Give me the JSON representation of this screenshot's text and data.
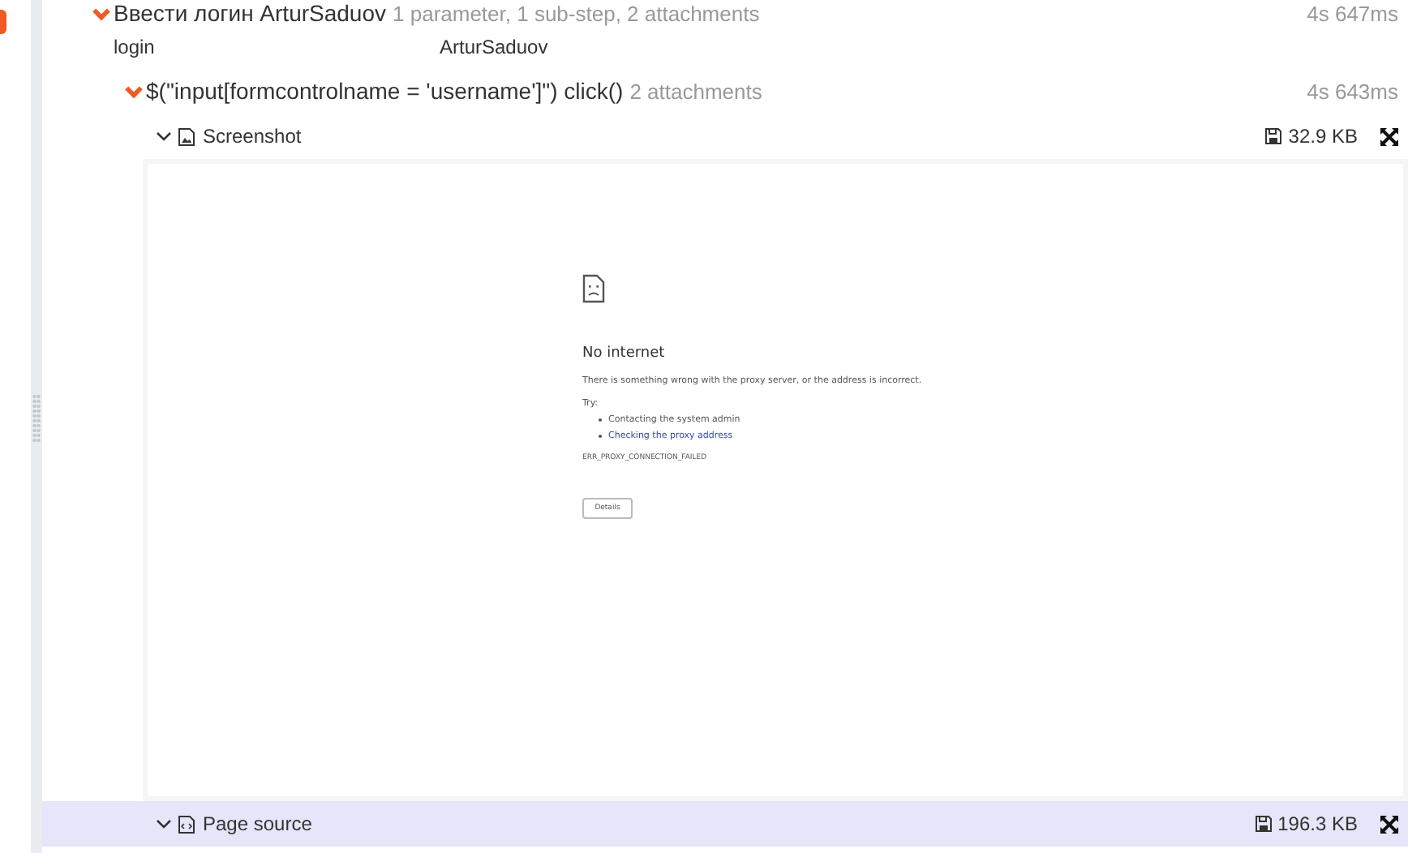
{
  "step": {
    "title": "Ввести логин ArturSaduov",
    "summary": "1 parameter, 1 sub-step, 2 attachments",
    "duration": "4s 647ms",
    "expanded": true,
    "parameters": [
      {
        "name": "login",
        "value": "ArturSaduov"
      }
    ],
    "substeps": [
      {
        "title": "$(\"input[formcontrolname = 'username']\") click()",
        "summary": "2 attachments",
        "duration": "4s 643ms",
        "expanded": true,
        "attachments": [
          {
            "kind": "image",
            "name": "Screenshot",
            "size": "32.9 KB",
            "expanded": true,
            "selected": false,
            "preview": {
              "title": "No internet",
              "message": "There is something wrong with the proxy server, or the address is incorrect.",
              "try_label": "Try:",
              "suggestions": [
                {
                  "kind": "text",
                  "text": "Contacting the system admin"
                },
                {
                  "kind": "link",
                  "text": "Checking the proxy address"
                }
              ],
              "error_code": "ERR_PROXY_CONNECTION_FAILED",
              "button": "Details"
            }
          },
          {
            "kind": "code",
            "name": "Page source",
            "size": "196.3 KB",
            "expanded": true,
            "selected": true
          }
        ]
      }
    ]
  }
}
